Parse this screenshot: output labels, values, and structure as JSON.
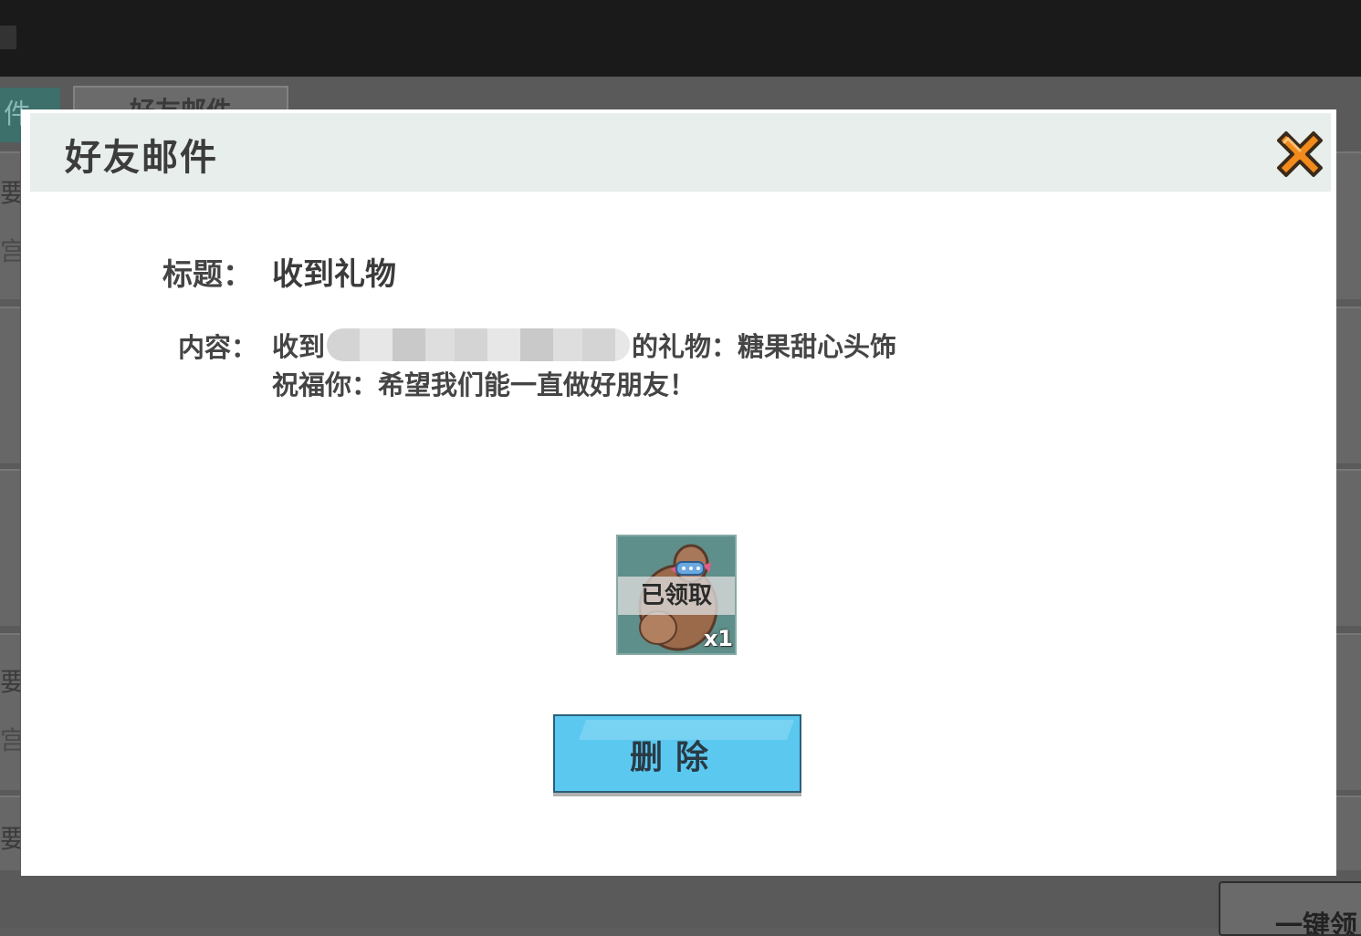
{
  "background": {
    "tab_left_label": "件",
    "tab_label": "好友邮件",
    "left_strip_chars": [
      "要",
      "宫",
      "要",
      "宫",
      "要"
    ],
    "bottom_right_button": "一键领"
  },
  "modal": {
    "title": "好友邮件",
    "subject_label": "标题：",
    "subject_value": "收到礼物",
    "content_label": "内容：",
    "content_prefix": "收到",
    "content_suffix": "的礼物：糖果甜心头饰",
    "content_line2": "祝福你：希望我们能一直做好朋友！",
    "item": {
      "icon": "candy-heart-headwear-icon",
      "status": "已领取",
      "quantity": "x1"
    },
    "delete_button": "删除"
  },
  "colors": {
    "header_bg": "#e7eeeb",
    "close_orange": "#f28a1c",
    "button_blue": "#5bc8f0"
  }
}
